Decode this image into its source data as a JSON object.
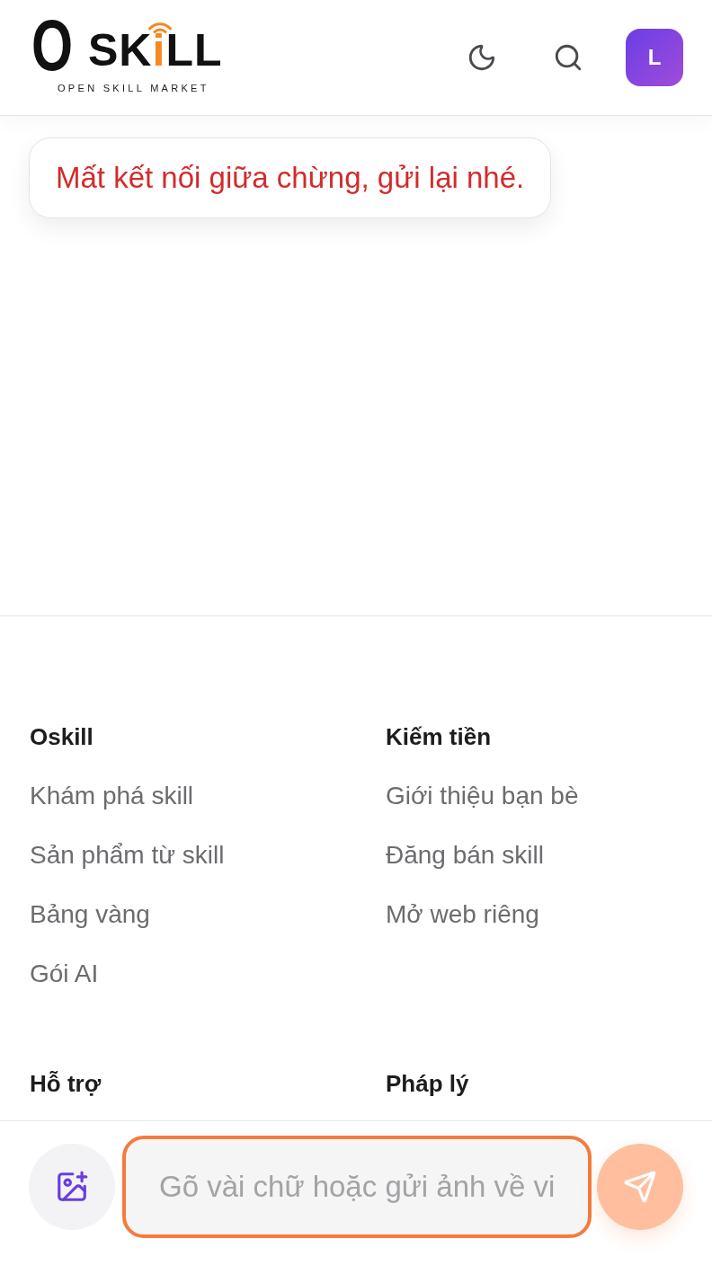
{
  "header": {
    "logo": {
      "letter": "O",
      "name_parts": [
        "SK",
        "i",
        "LL"
      ],
      "tagline": "OPEN SKILL MARKET"
    },
    "avatar": {
      "initial": "L"
    }
  },
  "chat": {
    "messages": [
      {
        "kind": "error",
        "text": "Mất kết nối giữa chừng, gửi lại nhé."
      }
    ]
  },
  "footer": {
    "sections": [
      {
        "title": "Oskill",
        "links": [
          "Khám phá skill",
          "Sản phẩm từ skill",
          "Bảng vàng",
          "Gói AI"
        ]
      },
      {
        "title": "Kiếm tiền",
        "links": [
          "Giới thiệu bạn bè",
          "Đăng bán skill",
          "Mở web riêng"
        ]
      },
      {
        "title": "Hỗ trợ"
      },
      {
        "title": "Pháp lý"
      }
    ]
  },
  "composer": {
    "placeholder": "Gõ vài chữ hoặc gửi ảnh về vi",
    "focused": true,
    "send_disabled": true
  }
}
